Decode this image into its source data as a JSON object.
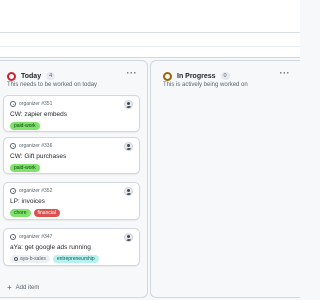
{
  "columns": [
    {
      "title": "Today",
      "count": "4",
      "description": "This needs to be worked on today",
      "status_color": "#cf222e",
      "add_item_label": "Add item",
      "cards": [
        {
          "meta": "organizer #351",
          "title": "CW: zapier embeds",
          "labels": [
            "paid-work"
          ]
        },
        {
          "meta": "organizer #336",
          "title": "CW: Gift purchases",
          "labels": [
            "paid-work"
          ]
        },
        {
          "meta": "organizer #352",
          "title": "LP: invoices",
          "labels": [
            "chore",
            "financial"
          ]
        },
        {
          "meta": "organizer #347",
          "title": "aYa: get google ads running",
          "labels": [
            "aya-b-sales",
            "entrepreneurship"
          ]
        }
      ]
    },
    {
      "title": "In Progress",
      "count": "0",
      "description": "This is actively being worked on",
      "status_color": "#9a6700"
    }
  ],
  "more_options_glyph": "···",
  "add_item_glyph": "+"
}
